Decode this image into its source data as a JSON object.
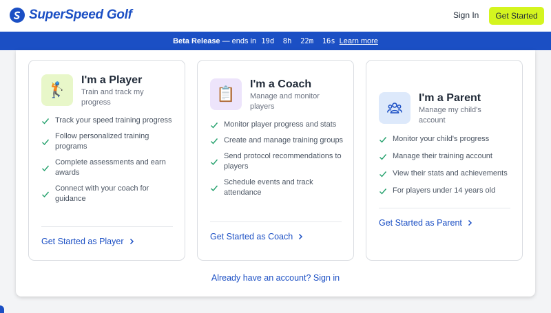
{
  "brand": {
    "name": "SuperSpeed Golf",
    "color": "#1b4fc4"
  },
  "nav": {
    "sign_in": "Sign In",
    "get_started": "Get Started",
    "cta_color": "#d4f51f"
  },
  "banner": {
    "bold": "Beta Release",
    "text": " — ends in ",
    "countdown": "19d  8h  22m  16s",
    "link": "Learn more"
  },
  "cards": [
    {
      "title": "I'm a Player",
      "subtitle": "Train and track my progress",
      "icon": "golfer-icon",
      "features": [
        "Track your speed training progress",
        "Follow personalized training programs",
        "Complete assessments and earn awards",
        "Connect with your coach for guidance"
      ],
      "link": "Get Started as Player"
    },
    {
      "title": "I'm a Coach",
      "subtitle": "Manage and monitor players",
      "icon": "clipboard-icon",
      "features": [
        "Monitor player progress and stats",
        "Create and manage training groups",
        "Send protocol recommendations to players",
        "Schedule events and track attendance"
      ],
      "link": "Get Started as Coach"
    },
    {
      "title": "I'm a Parent",
      "subtitle": "Manage my child's account",
      "icon": "family-icon",
      "features": [
        "Monitor your child's progress",
        "Manage their training account",
        "View their stats and achievements",
        "For players under 14 years old"
      ],
      "link": "Get Started as Parent"
    }
  ],
  "footer": {
    "already": "Already have an account? Sign in"
  }
}
